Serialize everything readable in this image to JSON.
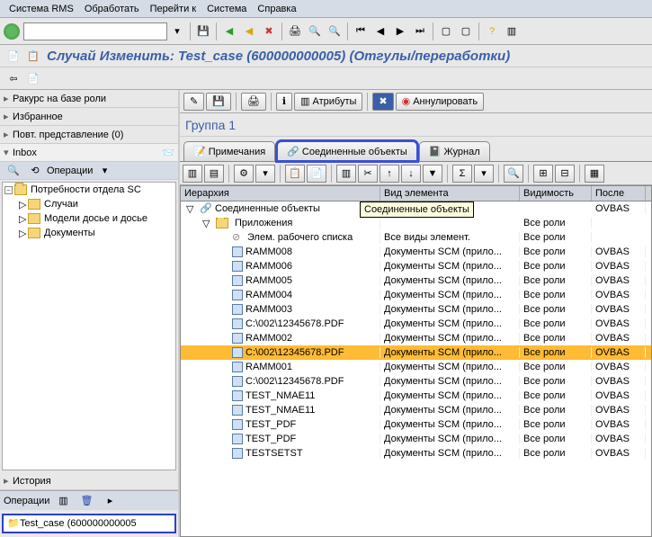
{
  "menubar": [
    "Система RMS",
    "Обработать",
    "Перейти к",
    "Система",
    "Справка"
  ],
  "title": "Случай Изменить: Test_case (600000000005) (Отгулы/переработки)",
  "left": {
    "rakurs": "Ракурс на базе роли",
    "fav": "Избранное",
    "povt": {
      "label": "Повт. представление (",
      "count": "0",
      "suffix": ")"
    },
    "inbox": "Inbox",
    "ops": "Операции",
    "tree": {
      "root": "Потребности отдела SC",
      "children": [
        "Случаи",
        "Модели досье и досье",
        "Документы"
      ]
    },
    "history": "История",
    "ops2": "Операции",
    "selected": "Test_case (600000000005"
  },
  "right": {
    "btn_attr": "Атрибуты",
    "btn_annul": "Аннулировать",
    "group": "Группа 1",
    "tabs": {
      "notes": "Примечания",
      "linked": "Соединенные объекты",
      "journal": "Журнал"
    },
    "tooltip": "Соединенные объекты",
    "columns": [
      "Иерархия",
      "Вид элемента",
      "Видимость",
      "После"
    ],
    "rows": [
      {
        "lvl": 0,
        "exp": "▽",
        "ico": "linked",
        "name": "Соединенные объекты",
        "type": "",
        "vis": "",
        "by": "OVBAS"
      },
      {
        "lvl": 1,
        "exp": "▽",
        "ico": "folder",
        "name": "Приложения",
        "type": "",
        "vis": "Все роли",
        "by": ""
      },
      {
        "lvl": 2,
        "exp": "",
        "ico": "stop",
        "name": "Элем. рабочего списка",
        "type": "Все виды элемент.",
        "vis": "Все роли",
        "by": ""
      },
      {
        "lvl": 2,
        "exp": "",
        "ico": "doc",
        "name": "RAMM008",
        "type": "Документы SCM (прило...",
        "vis": "Все роли",
        "by": "OVBAS"
      },
      {
        "lvl": 2,
        "exp": "",
        "ico": "doc",
        "name": "RAMM006",
        "type": "Документы SCM (прило...",
        "vis": "Все роли",
        "by": "OVBAS"
      },
      {
        "lvl": 2,
        "exp": "",
        "ico": "doc",
        "name": "RAMM005",
        "type": "Документы SCM (прило...",
        "vis": "Все роли",
        "by": "OVBAS"
      },
      {
        "lvl": 2,
        "exp": "",
        "ico": "doc",
        "name": "RAMM004",
        "type": "Документы SCM (прило...",
        "vis": "Все роли",
        "by": "OVBAS"
      },
      {
        "lvl": 2,
        "exp": "",
        "ico": "doc",
        "name": "RAMM003",
        "type": "Документы SCM (прило...",
        "vis": "Все роли",
        "by": "OVBAS"
      },
      {
        "lvl": 2,
        "exp": "",
        "ico": "doc",
        "name": "C:\\002\\12345678.PDF",
        "type": "Документы SCM (прило...",
        "vis": "Все роли",
        "by": "OVBAS"
      },
      {
        "lvl": 2,
        "exp": "",
        "ico": "doc",
        "name": "RAMM002",
        "type": "Документы SCM (прило...",
        "vis": "Все роли",
        "by": "OVBAS"
      },
      {
        "lvl": 2,
        "exp": "",
        "ico": "doc",
        "name": "C:\\002\\12345678.PDF",
        "type": "Документы SCM (прило...",
        "vis": "Все роли",
        "by": "OVBAS",
        "sel": true
      },
      {
        "lvl": 2,
        "exp": "",
        "ico": "doc",
        "name": "RAMM001",
        "type": "Документы SCM (прило...",
        "vis": "Все роли",
        "by": "OVBAS"
      },
      {
        "lvl": 2,
        "exp": "",
        "ico": "doc",
        "name": "C:\\002\\12345678.PDF",
        "type": "Документы SCM (прило...",
        "vis": "Все роли",
        "by": "OVBAS"
      },
      {
        "lvl": 2,
        "exp": "",
        "ico": "doc",
        "name": "TEST_NMAE11",
        "type": "Документы SCM (прило...",
        "vis": "Все роли",
        "by": "OVBAS"
      },
      {
        "lvl": 2,
        "exp": "",
        "ico": "doc",
        "name": "TEST_NMAE11",
        "type": "Документы SCM (прило...",
        "vis": "Все роли",
        "by": "OVBAS"
      },
      {
        "lvl": 2,
        "exp": "",
        "ico": "doc",
        "name": "TEST_PDF",
        "type": "Документы SCM (прило...",
        "vis": "Все роли",
        "by": "OVBAS"
      },
      {
        "lvl": 2,
        "exp": "",
        "ico": "doc",
        "name": "TEST_PDF",
        "type": "Документы SCM (прило...",
        "vis": "Все роли",
        "by": "OVBAS"
      },
      {
        "lvl": 2,
        "exp": "",
        "ico": "doc",
        "name": "TESTSETST",
        "type": "Документы SCM (прило...",
        "vis": "Все роли",
        "by": "OVBAS"
      }
    ]
  }
}
